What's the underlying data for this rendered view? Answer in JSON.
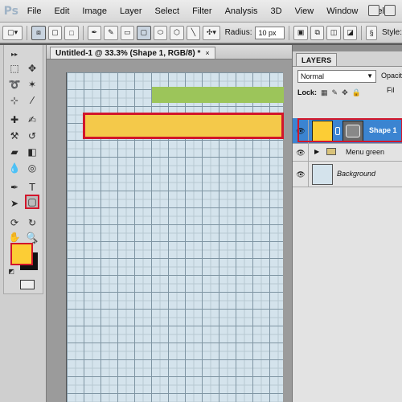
{
  "app": {
    "logo": "Ps"
  },
  "menu": [
    "File",
    "Edit",
    "Image",
    "Layer",
    "Select",
    "Filter",
    "Analysis",
    "3D",
    "View",
    "Window",
    "Help"
  ],
  "options_bar": {
    "radius_label": "Radius:",
    "radius_value": "10 px",
    "style_label": "Style:"
  },
  "document": {
    "tab_title": "Untitled-1 @ 33.3% (Shape 1, RGB/8) *",
    "close": "×"
  },
  "toolbox": {
    "foreground_color": "#fccd35",
    "background_color": "#111111",
    "highlighted_tool": "rounded-rectangle-tool"
  },
  "canvas": {
    "grid_color": "#d4e3ec",
    "green_bar_color": "#9cc55a",
    "yellow_bar_color": "#f4c94a",
    "highlight_color": "#d2162b"
  },
  "layers": {
    "panel_title": "LAYERS",
    "blend_mode": "Normal",
    "opacity_label": "Opacity",
    "lock_label": "Lock:",
    "fill_label": "Fil",
    "items": [
      {
        "name": "Shape 1",
        "active": true
      },
      {
        "name": "Menu green",
        "active": false,
        "type": "group"
      },
      {
        "name": "Background",
        "active": false
      }
    ]
  }
}
